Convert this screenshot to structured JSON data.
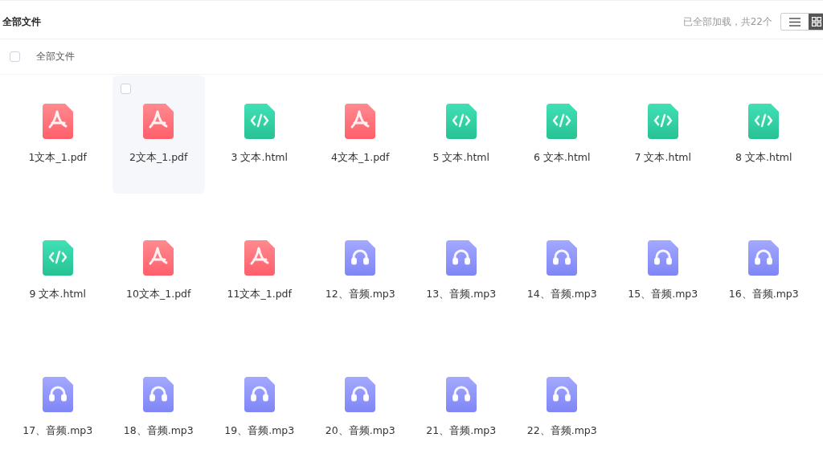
{
  "header": {
    "title": "全部文件",
    "status": "已全部加载，共22个",
    "views": [
      {
        "kind": "list",
        "selected": false
      },
      {
        "kind": "grid",
        "selected": true
      }
    ]
  },
  "toolbar": {
    "select_all_checked": false,
    "label": "全部文件"
  },
  "files": [
    {
      "name": "1文本_1.pdf",
      "kind": "pdf",
      "highlighted": false
    },
    {
      "name": "2文本_1.pdf",
      "kind": "pdf",
      "highlighted": true
    },
    {
      "name": "3 文本.html",
      "kind": "html",
      "highlighted": false
    },
    {
      "name": "4文本_1.pdf",
      "kind": "pdf",
      "highlighted": false
    },
    {
      "name": "5 文本.html",
      "kind": "html",
      "highlighted": false
    },
    {
      "name": "6 文本.html",
      "kind": "html",
      "highlighted": false
    },
    {
      "name": "7 文本.html",
      "kind": "html",
      "highlighted": false
    },
    {
      "name": "8 文本.html",
      "kind": "html",
      "highlighted": false
    },
    {
      "name": "9 文本.html",
      "kind": "html",
      "highlighted": false
    },
    {
      "name": "10文本_1.pdf",
      "kind": "pdf",
      "highlighted": false
    },
    {
      "name": "11文本_1.pdf",
      "kind": "pdf",
      "highlighted": false
    },
    {
      "name": "12、音频.mp3",
      "kind": "audio",
      "highlighted": false
    },
    {
      "name": "13、音频.mp3",
      "kind": "audio",
      "highlighted": false
    },
    {
      "name": "14、音频.mp3",
      "kind": "audio",
      "highlighted": false
    },
    {
      "name": "15、音频.mp3",
      "kind": "audio",
      "highlighted": false
    },
    {
      "name": "16、音频.mp3",
      "kind": "audio",
      "highlighted": false
    },
    {
      "name": "17、音频.mp3",
      "kind": "audio",
      "highlighted": false
    },
    {
      "name": "18、音频.mp3",
      "kind": "audio",
      "highlighted": false
    },
    {
      "name": "19、音频.mp3",
      "kind": "audio",
      "highlighted": false
    },
    {
      "name": "20、音频.mp3",
      "kind": "audio",
      "highlighted": false
    },
    {
      "name": "21、音频.mp3",
      "kind": "audio",
      "highlighted": false
    },
    {
      "name": "22、音频.mp3",
      "kind": "audio",
      "highlighted": false
    }
  ]
}
